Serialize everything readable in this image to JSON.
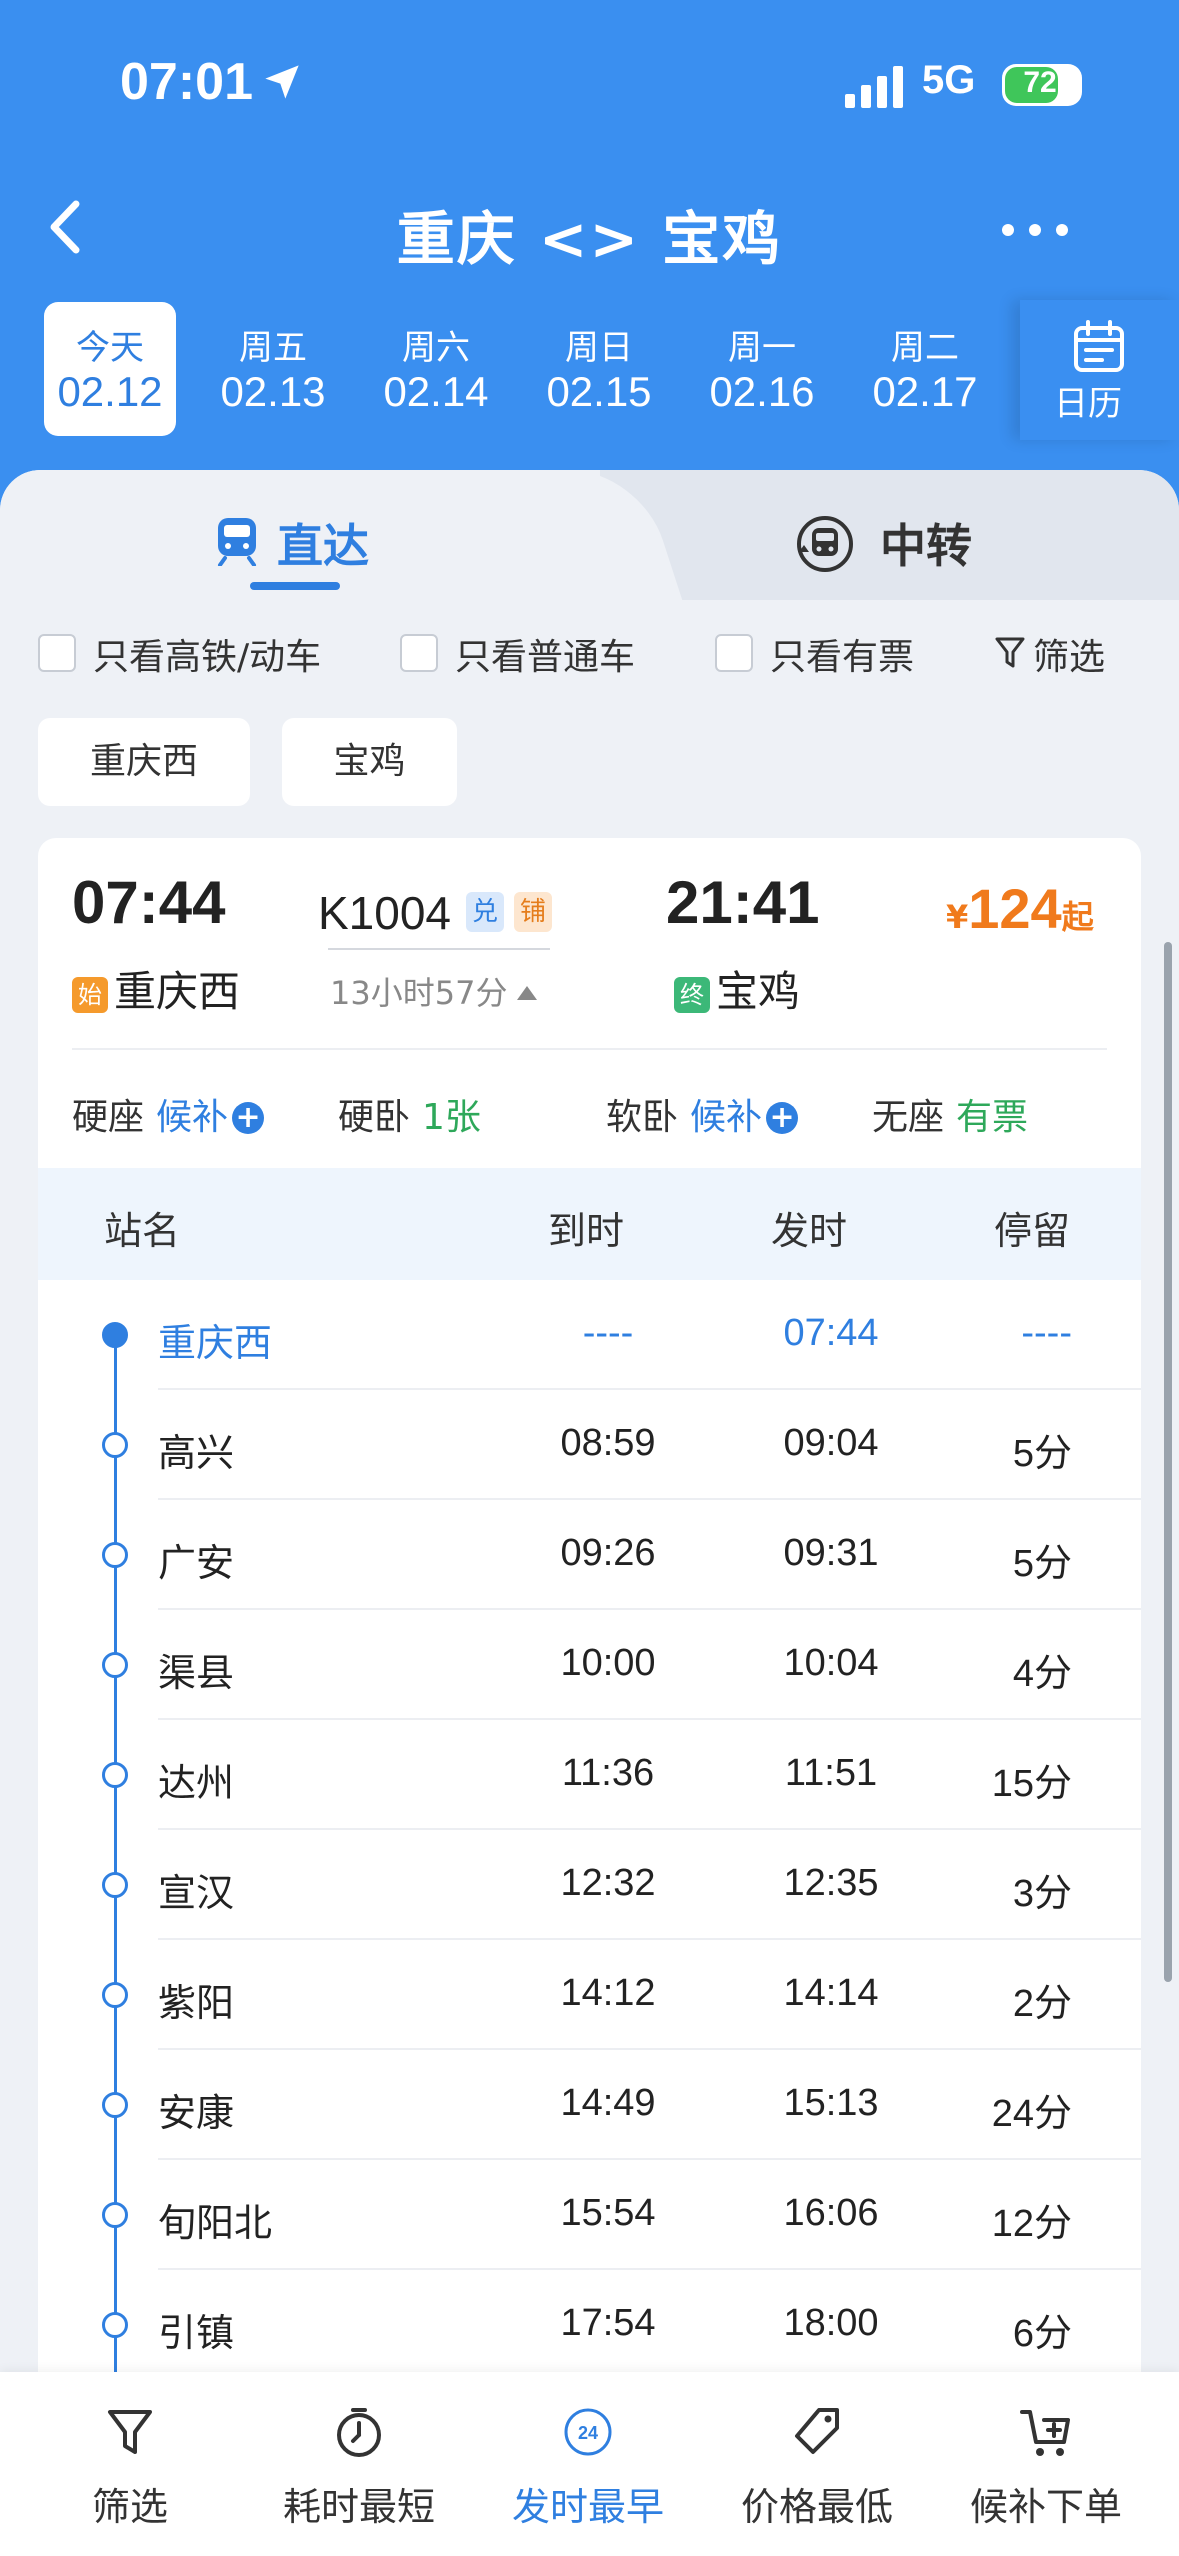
{
  "status_bar": {
    "time": "07:01",
    "network": "5G",
    "battery": "72",
    "battery_level": 0.72
  },
  "nav": {
    "title": "重庆 <> 宝鸡"
  },
  "dates": [
    {
      "weekday": "今天",
      "date": "02.12",
      "active": true
    },
    {
      "weekday": "周五",
      "date": "02.13"
    },
    {
      "weekday": "周六",
      "date": "02.14"
    },
    {
      "weekday": "周日",
      "date": "02.15"
    },
    {
      "weekday": "周一",
      "date": "02.16"
    },
    {
      "weekday": "周二",
      "date": "02.17"
    }
  ],
  "calendar_label": "日历",
  "mode_tabs": {
    "direct": "直达",
    "transfer": "中转"
  },
  "filters": {
    "high_speed": "只看高铁/动车",
    "normal": "只看普通车",
    "available": "只看有票",
    "filter": "筛选"
  },
  "station_chips": [
    "重庆西",
    "宝鸡"
  ],
  "train": {
    "dep_time": "07:44",
    "dep_badge": "始",
    "dep_station": "重庆西",
    "number": "K1004",
    "tag1": "兑",
    "tag2": "铺",
    "duration": "13小时57分",
    "arr_time": "21:41",
    "arr_badge": "终",
    "arr_station": "宝鸡",
    "price_currency": "¥",
    "price": "124",
    "price_suffix": "起",
    "seats": [
      {
        "name": "硬座",
        "status": "候补",
        "plus": true,
        "color": "blue"
      },
      {
        "name": "硬卧",
        "status": "1张",
        "plus": false,
        "color": "green"
      },
      {
        "name": "软卧",
        "status": "候补",
        "plus": true,
        "color": "blue"
      },
      {
        "name": "无座",
        "status": "有票",
        "plus": false,
        "color": "green"
      }
    ]
  },
  "stops_header": {
    "station": "站名",
    "arrive": "到时",
    "depart": "发时",
    "stay": "停留"
  },
  "stops": [
    {
      "name": "重庆西",
      "arrive": "----",
      "depart": "07:44",
      "stay": "----"
    },
    {
      "name": "高兴",
      "arrive": "08:59",
      "depart": "09:04",
      "stay": "5分"
    },
    {
      "name": "广安",
      "arrive": "09:26",
      "depart": "09:31",
      "stay": "5分"
    },
    {
      "name": "渠县",
      "arrive": "10:00",
      "depart": "10:04",
      "stay": "4分"
    },
    {
      "name": "达州",
      "arrive": "11:36",
      "depart": "11:51",
      "stay": "15分"
    },
    {
      "name": "宣汉",
      "arrive": "12:32",
      "depart": "12:35",
      "stay": "3分"
    },
    {
      "name": "紫阳",
      "arrive": "14:12",
      "depart": "14:14",
      "stay": "2分"
    },
    {
      "name": "安康",
      "arrive": "14:49",
      "depart": "15:13",
      "stay": "24分"
    },
    {
      "name": "旬阳北",
      "arrive": "15:54",
      "depart": "16:06",
      "stay": "12分"
    },
    {
      "name": "引镇",
      "arrive": "17:54",
      "depart": "18:00",
      "stay": "6分"
    }
  ],
  "bottom_bar": {
    "filter": "筛选",
    "shortest": "耗时最短",
    "earliest": "发时最早",
    "earliest_icon_text": "24",
    "cheapest": "价格最低",
    "waitlist": "候补下单"
  },
  "colors": {
    "primary": "#3a8ff0",
    "accent_blue": "#2f7fe0",
    "price_orange": "#f07a1c",
    "green": "#2ea85a"
  }
}
